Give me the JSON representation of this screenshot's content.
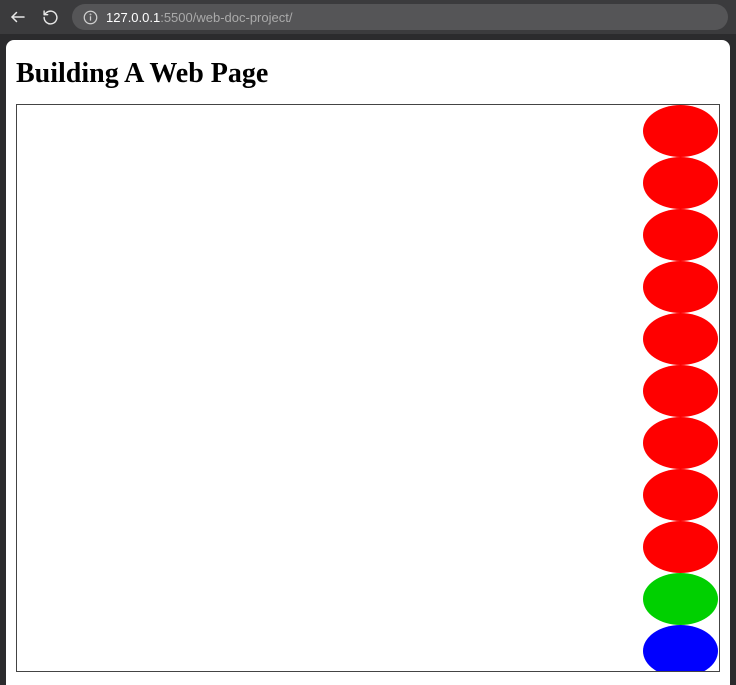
{
  "browser": {
    "url_host": "127.0.0.1",
    "url_rest": ":5500/web-doc-project/"
  },
  "page": {
    "title": "Building A Web Page"
  },
  "shapes": {
    "colors": {
      "red": "#ff0000",
      "green": "#00d000",
      "blue": "#0000ff"
    },
    "items": [
      {
        "color": "red"
      },
      {
        "color": "red"
      },
      {
        "color": "red"
      },
      {
        "color": "red"
      },
      {
        "color": "red"
      },
      {
        "color": "red"
      },
      {
        "color": "red"
      },
      {
        "color": "red"
      },
      {
        "color": "red"
      },
      {
        "color": "green"
      },
      {
        "color": "blue"
      }
    ]
  }
}
